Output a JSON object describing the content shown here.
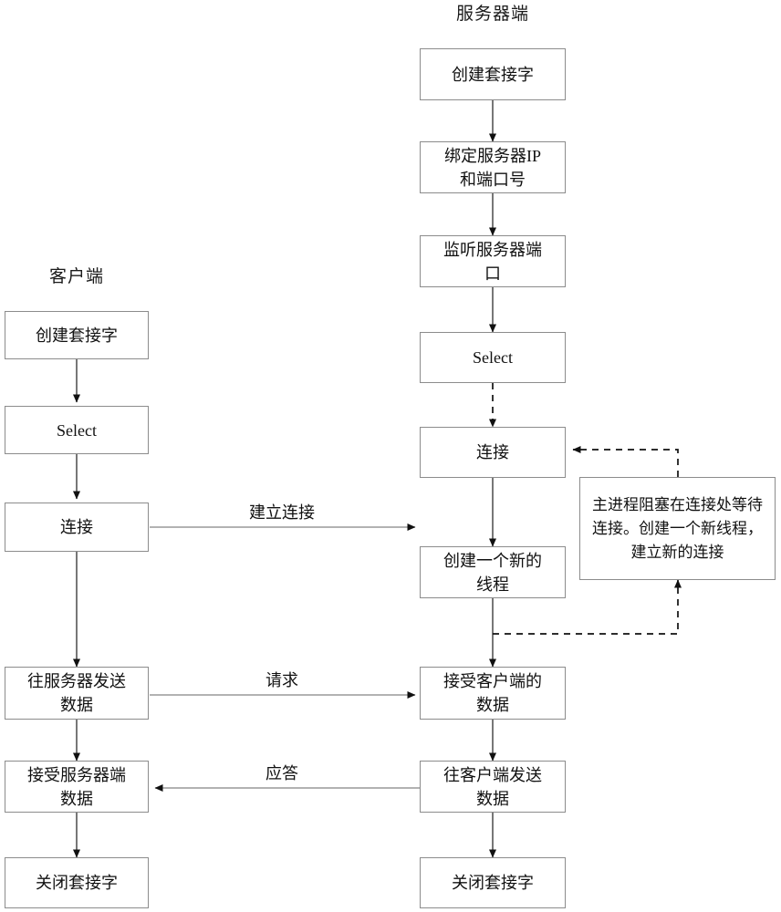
{
  "diagram": {
    "title_client": "客户端",
    "title_server": "服务器端",
    "columns": {
      "client": {
        "label": "客户端",
        "nodes": [
          {
            "id": "c1",
            "text": "创建套接字"
          },
          {
            "id": "c2",
            "text": "Select"
          },
          {
            "id": "c3",
            "text": "连接"
          },
          {
            "id": "c4",
            "text": "往服务器发送\n数据"
          },
          {
            "id": "c5",
            "text": "接受服务器端\n数据"
          },
          {
            "id": "c6",
            "text": "关闭套接字"
          }
        ]
      },
      "server": {
        "label": "服务器端",
        "nodes": [
          {
            "id": "s1",
            "text": "创建套接字"
          },
          {
            "id": "s2",
            "text": "绑定服务器IP\n和端口号"
          },
          {
            "id": "s3",
            "text": "监听服务器端\n口"
          },
          {
            "id": "s4",
            "text": "Select"
          },
          {
            "id": "s5",
            "text": "连接"
          },
          {
            "id": "s6",
            "text": "创建一个新的\n线程"
          },
          {
            "id": "s7",
            "text": "接受客户端的\n数据"
          },
          {
            "id": "s8",
            "text": "往客户端发送\n数据"
          },
          {
            "id": "s9",
            "text": "关闭套接字"
          }
        ]
      }
    },
    "annotation": {
      "text": "主进程阻塞在连接处等待连接。创建一个新线程，建立新的连接"
    },
    "edge_labels": {
      "establish": "建立连接",
      "request": "请求",
      "response": "应答"
    },
    "colors": {
      "border": "#8c8c8c",
      "line": "#555555",
      "text": "#111111",
      "background": "#ffffff"
    }
  }
}
